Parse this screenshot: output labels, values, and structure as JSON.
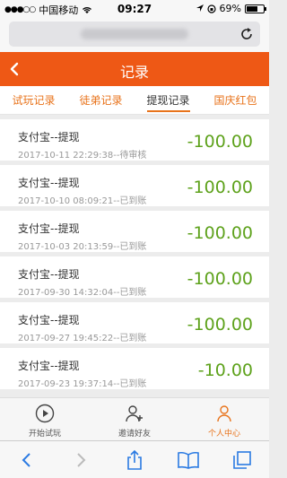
{
  "status_bar": {
    "carrier": "中国移动",
    "time": "09:27",
    "battery": "69%",
    "battery_level": 0.69
  },
  "header": {
    "title": "记录"
  },
  "tabs": [
    {
      "label": "试玩记录",
      "active": false
    },
    {
      "label": "徒弟记录",
      "active": false
    },
    {
      "label": "提现记录",
      "active": true
    },
    {
      "label": "国庆红包",
      "active": false
    }
  ],
  "records": [
    {
      "name": "支付宝--提现",
      "meta": "2017-10-11 22:29:38--待审核",
      "amount": "-100.00"
    },
    {
      "name": "支付宝--提现",
      "meta": "2017-10-10 08:09:21--已到账",
      "amount": "-100.00"
    },
    {
      "name": "支付宝--提现",
      "meta": "2017-10-03 20:13:59--已到账",
      "amount": "-100.00"
    },
    {
      "name": "支付宝--提现",
      "meta": "2017-09-30 14:32:04--已到账",
      "amount": "-100.00"
    },
    {
      "name": "支付宝--提现",
      "meta": "2017-09-27 19:45:22--已到账",
      "amount": "-100.00"
    },
    {
      "name": "支付宝--提现",
      "meta": "2017-09-23 19:37:14--已到账",
      "amount": "-10.00"
    }
  ],
  "bottom_nav": [
    {
      "label": "开始试玩",
      "icon": "play-icon",
      "active": false
    },
    {
      "label": "邀请好友",
      "icon": "add-user-icon",
      "active": false
    },
    {
      "label": "个人中心",
      "icon": "user-icon",
      "active": true
    }
  ],
  "colors": {
    "accent": "#ee5815",
    "tab_text": "#e8731b",
    "amount": "#5ea21c"
  }
}
